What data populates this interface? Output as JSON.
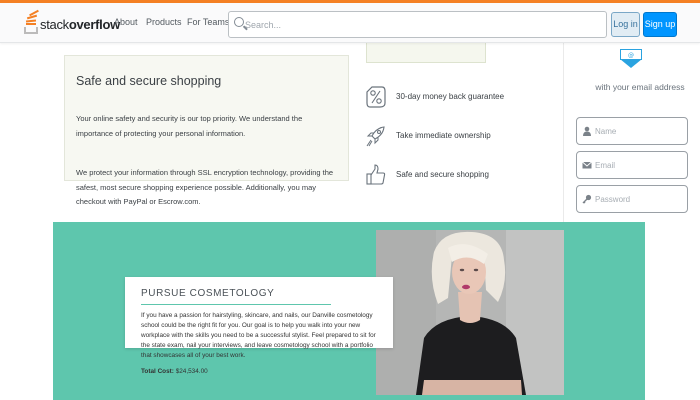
{
  "header": {
    "logo_light": "stack",
    "logo_bold": "overflow",
    "nav": [
      "About",
      "Products",
      "For Teams"
    ],
    "search_placeholder": "Search...",
    "login_label": "Log in",
    "signup_label": "Sign up",
    "accent_color": "#f48024"
  },
  "secure_section": {
    "title": "Safe and secure shopping",
    "paragraph_1": "Your online safety and security is our top priority. We understand the importance of protecting your personal information.",
    "paragraph_2": "We protect your information through SSL encryption technology, providing the safest, most secure shopping experience possible. Additionally, you may checkout with PayPal or Escrow.com."
  },
  "features": [
    {
      "icon": "percent-icon",
      "label": "30-day money back guarantee"
    },
    {
      "icon": "rocket-icon",
      "label": "Take immediate ownership"
    },
    {
      "icon": "thumbs-up-icon",
      "label": "Safe and secure shopping"
    }
  ],
  "signup_panel": {
    "caption": "with your email address",
    "name_placeholder": "Name",
    "email_placeholder": "Email",
    "password_placeholder": "Password",
    "accent_color": "#0095ff"
  },
  "banner": {
    "title": "PURSUE COSMETOLOGY",
    "body": "If you have a passion for hairstyling, skincare, and nails, our Danville cosmetology school could be the right fit for you. Our goal is to help you walk into your new workplace with the skills you need to be a successful stylist. Feel prepared to sit for the state exam, nail your interviews, and leave cosmetology school with a portfolio that showcases all of your best work.",
    "cost_label": "Total Cost:",
    "cost_value": "$24,534.00",
    "background_color": "#5ec6ad"
  }
}
